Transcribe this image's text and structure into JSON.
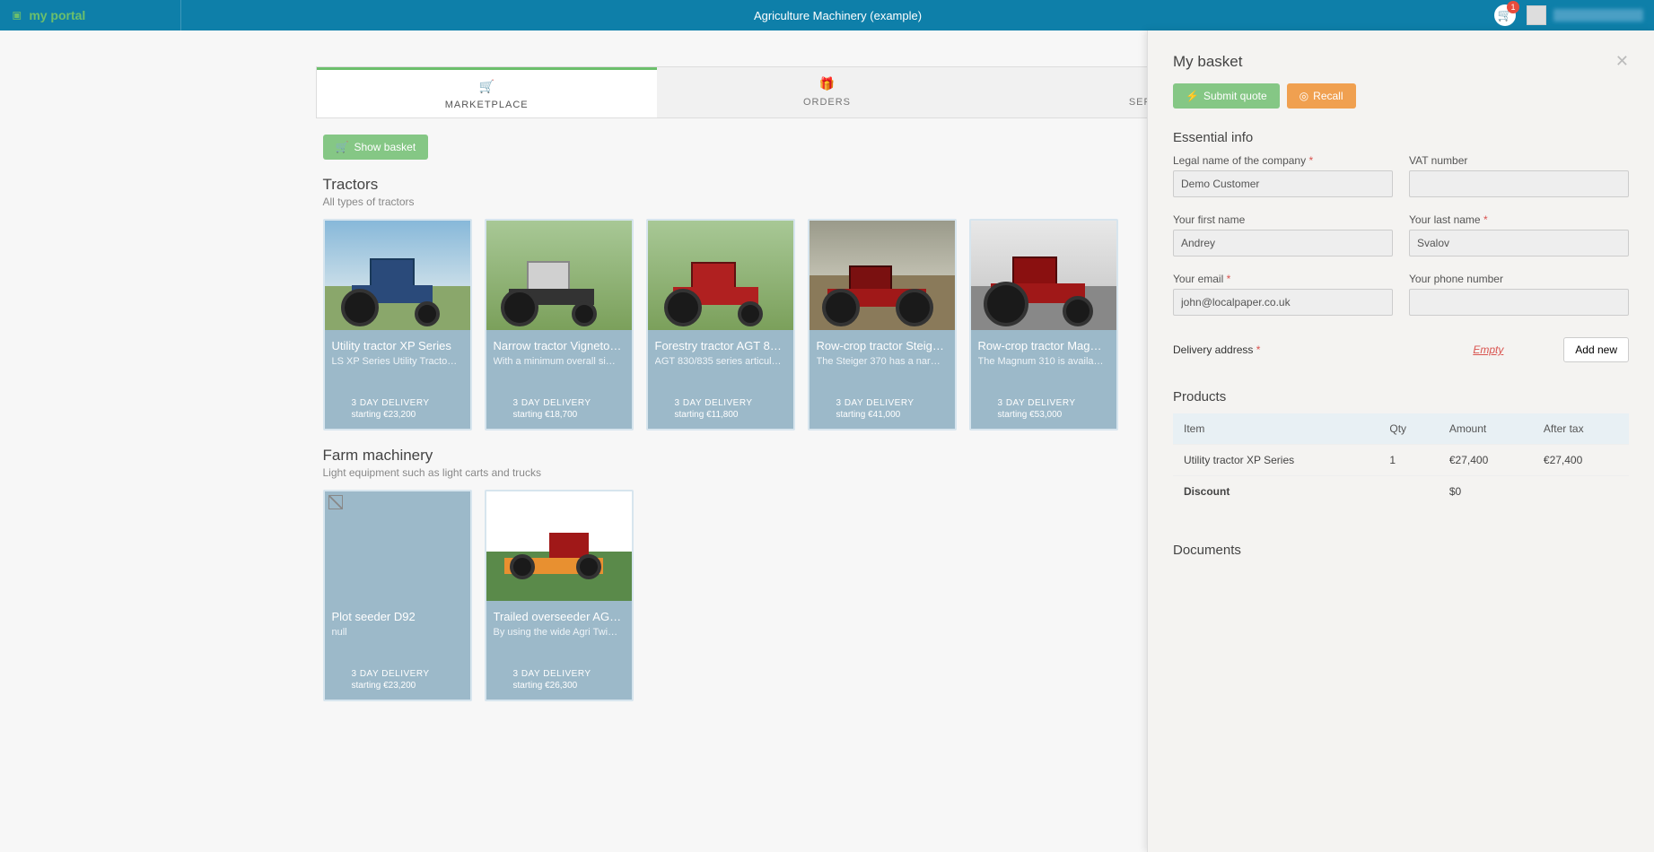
{
  "header": {
    "logo_text": "my portal",
    "title": "Agriculture Machinery (example)",
    "cart_count": "1"
  },
  "tabs": [
    {
      "label": "MARKETPLACE",
      "icon": "cart"
    },
    {
      "label": "ORDERS",
      "icon": "gift"
    },
    {
      "label": "SERVICE REQ",
      "icon": "check"
    }
  ],
  "show_basket_label": "Show basket",
  "sections": [
    {
      "title": "Tractors",
      "subtitle": "All types of tractors",
      "items": [
        {
          "title": "Utility tractor XP Series",
          "desc": "LS XP Series Utility Tracto…",
          "delivery": "3 DAY DELIVERY",
          "price": "starting €23,200"
        },
        {
          "title": "Narrow tractor Vigneto…",
          "desc": "With a minimum overall si…",
          "delivery": "3 DAY DELIVERY",
          "price": "starting €18,700"
        },
        {
          "title": "Forestry tractor AGT 8…",
          "desc": "AGT 830/835 series articul…",
          "delivery": "3 DAY DELIVERY",
          "price": "starting €11,800"
        },
        {
          "title": "Row-crop tractor Steig…",
          "desc": "The Steiger 370 has a nar…",
          "delivery": "3 DAY DELIVERY",
          "price": "starting €41,000"
        },
        {
          "title": "Row-crop tractor Mag…",
          "desc": "The Magnum 310 is availa…",
          "delivery": "3 DAY DELIVERY",
          "price": "starting €53,000"
        }
      ]
    },
    {
      "title": "Farm machinery",
      "subtitle": "Light equipment such as light carts and trucks",
      "items": [
        {
          "title": "Plot seeder D92",
          "desc": "null",
          "delivery": "3 DAY DELIVERY",
          "price": "starting €23,200",
          "broken": true
        },
        {
          "title": "Trailed overseeder AG…",
          "desc": "By using the wide Agri Twi…",
          "delivery": "3 DAY DELIVERY",
          "price": "starting €26,300"
        }
      ]
    }
  ],
  "basket": {
    "title": "My basket",
    "submit_label": "Submit quote",
    "recall_label": "Recall",
    "essential_title": "Essential info",
    "fields": {
      "company_label": "Legal name of the company",
      "company_value": "Demo Customer",
      "vat_label": "VAT number",
      "vat_value": "",
      "firstname_label": "Your first name",
      "firstname_value": "Andrey",
      "lastname_label": "Your last name",
      "lastname_value": "Svalov",
      "email_label": "Your email",
      "email_value": "john@localpaper.co.uk",
      "phone_label": "Your phone number",
      "phone_value": ""
    },
    "delivery_label": "Delivery address",
    "empty_text": "Empty",
    "add_new_label": "Add new",
    "products_title": "Products",
    "table_headers": {
      "item": "Item",
      "qty": "Qty",
      "amount": "Amount",
      "after_tax": "After tax"
    },
    "rows": [
      {
        "item": "Utility tractor XP Series",
        "qty": "1",
        "amount": "€27,400",
        "after_tax": "€27,400"
      }
    ],
    "discount_label": "Discount",
    "discount_value": "$0",
    "documents_title": "Documents"
  }
}
